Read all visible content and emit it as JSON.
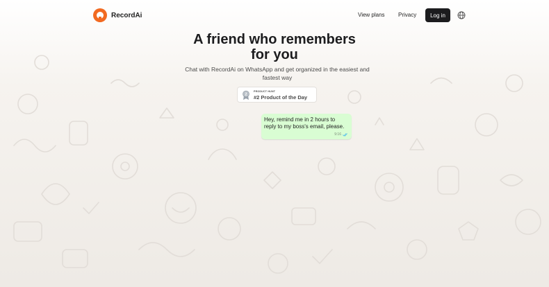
{
  "brand": {
    "name": "RecordAi",
    "accent": "#f26a21"
  },
  "nav": {
    "view_plans": "View plans",
    "privacy": "Privacy",
    "login": "Log in",
    "language_icon": "globe-icon"
  },
  "hero": {
    "title_line1": "A friend who remembers",
    "title_line2": "for you",
    "subtitle": "Chat with RecordAi on WhatsApp and get organized in the easiest and fastest way"
  },
  "badge": {
    "label_small": "PRODUCT HUNT",
    "label_big": "#2 Product of the Day",
    "icon": "medal-icon"
  },
  "chat": {
    "message": "Hey, remind me in 2 hours to reply to my boss's email, please.",
    "time": "9:16",
    "status_icon": "double-check-icon",
    "bubble_color": "#d9fdd3"
  },
  "background": {
    "pattern": "doodle-pattern"
  }
}
